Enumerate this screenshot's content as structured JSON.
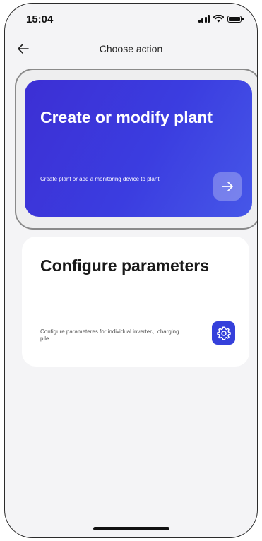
{
  "status_bar": {
    "time": "15:04"
  },
  "nav": {
    "title": "Choose action"
  },
  "cards": {
    "plant": {
      "title": "Create or modify plant",
      "description": "Create plant or add a monitoring device to plant"
    },
    "configure": {
      "title": "Configure parameters",
      "description": "Configure parameteres for individual inverter、charging pile"
    }
  },
  "colors": {
    "accent": "#3b3de0",
    "gear_button": "#3540db",
    "background": "#f4f4f6"
  }
}
